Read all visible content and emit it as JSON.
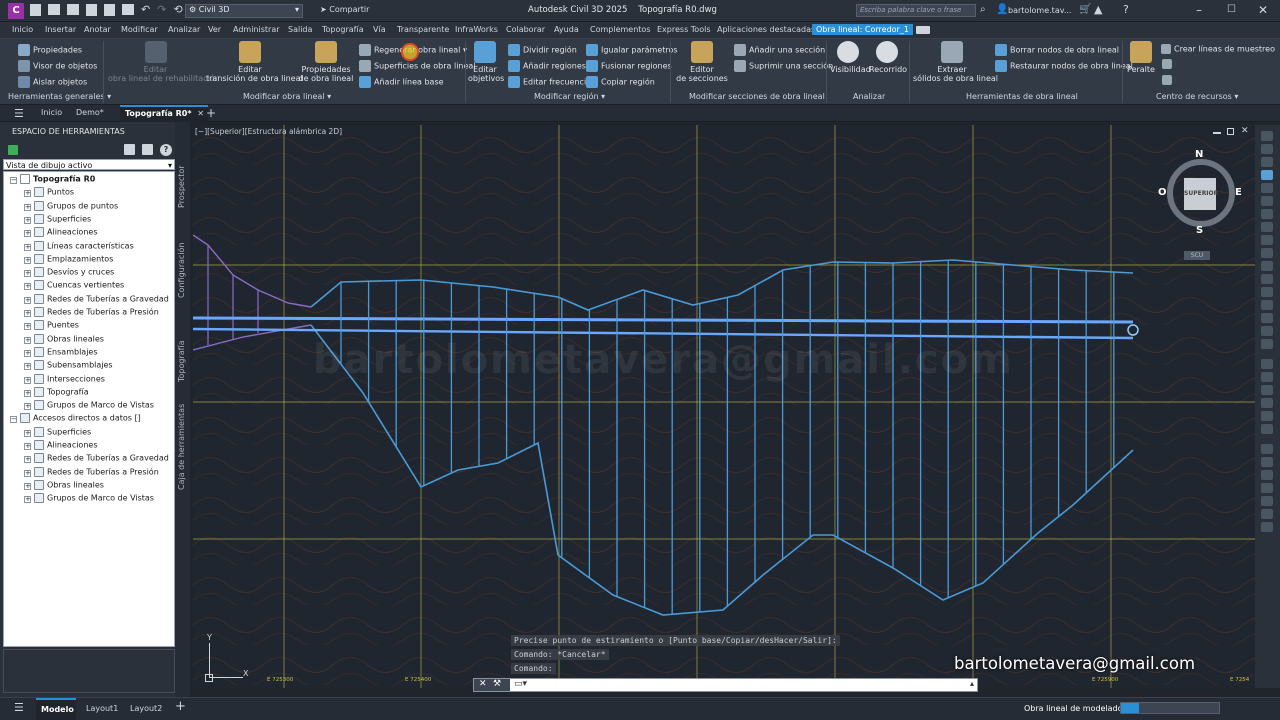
{
  "titlebar": {
    "app_badge": "C",
    "workspace": "Civil 3D",
    "share": "Compartir",
    "title": "Autodesk Civil 3D 2025    Topografía R0.dwg",
    "search_placeholder": "Escriba palabra clave o frase",
    "user": "bartolome.tav..."
  },
  "menu": [
    "Inicio",
    "Insertar",
    "Anotar",
    "Modificar",
    "Analizar",
    "Ver",
    "Administrar",
    "Salida",
    "Topografía",
    "Vía",
    "Transparente",
    "InfraWorks",
    "Colaborar",
    "Ayuda",
    "Complementos",
    "Express Tools",
    "Aplicaciones destacadas",
    "Obra lineal: Corredor_1"
  ],
  "ribbon": {
    "general": {
      "props": "Propiedades",
      "viewer": "Visor de objetos",
      "isolate": "Aislar objetos",
      "section": "Herramientas generales"
    },
    "modify_corridor": {
      "edit_rehab_1": "Editar",
      "edit_rehab_2": "obra lineal de rehabilitación",
      "edit_trans_1": "Editar",
      "edit_trans_2": "transición de obra lineal",
      "props_1": "Propiedades",
      "props_2": "de obra lineal",
      "regen": "Regenerar obra lineal",
      "surfaces": "Superficies de obra lineal",
      "add_baseline": "Añadir línea base",
      "section": "Modificar obra lineal"
    },
    "modify_region": {
      "edit_targets_1": "Editar",
      "edit_targets_2": "objetivos",
      "split": "Dividir región",
      "add": "Añadir regiones",
      "freq": "Editar frecuencia",
      "match": "Igualar parámetros",
      "merge": "Fusionar regiones",
      "copy": "Copiar región",
      "section": "Modificar región"
    },
    "modify_sections": {
      "editor_1": "Editor",
      "editor_2": "de secciones",
      "add": "Añadir una sección",
      "remove": "Suprimir una sección",
      "section": "Modificar secciones de obra lineal"
    },
    "analyze": {
      "visibility": "Visibilidad",
      "drive": "Recorrido",
      "section": "Analizar"
    },
    "tools": {
      "extract_1": "Extraer",
      "extract_2": "sólidos de obra lineal",
      "delete_nodes": "Borrar nodos de obra lineal",
      "restore_nodes": "Restaurar nodos de obra lineal",
      "section": "Herramientas de obra lineal"
    },
    "resources": {
      "profile": "Peralte",
      "sample": "Crear líneas de muestreo",
      "section": "Centro de recursos"
    }
  },
  "doctabs": [
    "Inicio",
    "Demo*",
    "Topografía R0*"
  ],
  "toolspace": {
    "title": "ESPACIO DE HERRAMIENTAS",
    "view_select": "Vista de dibujo activo",
    "side_tabs": [
      "Prospector",
      "Configuración",
      "Topografía",
      "Caja de herramientas"
    ],
    "tree": [
      {
        "label": "Topografía R0",
        "level": 0,
        "bold": true
      },
      {
        "label": "Puntos",
        "level": 1
      },
      {
        "label": "Grupos de puntos",
        "level": 1
      },
      {
        "label": "Superficies",
        "level": 1
      },
      {
        "label": "Alineaciones",
        "level": 1
      },
      {
        "label": "Líneas características",
        "level": 1
      },
      {
        "label": "Emplazamientos",
        "level": 1
      },
      {
        "label": "Desvíos y cruces",
        "level": 1
      },
      {
        "label": "Cuencas vertientes",
        "level": 1
      },
      {
        "label": "Redes de Tuberías a Gravedad",
        "level": 1
      },
      {
        "label": "Redes de Tuberías a Presión",
        "level": 1
      },
      {
        "label": "Puentes",
        "level": 1
      },
      {
        "label": "Obras lineales",
        "level": 1
      },
      {
        "label": "Ensamblajes",
        "level": 1
      },
      {
        "label": "Subensamblajes",
        "level": 1
      },
      {
        "label": "Intersecciones",
        "level": 1
      },
      {
        "label": "Topografía",
        "level": 1
      },
      {
        "label": "Grupos de Marco de Vistas",
        "level": 1
      },
      {
        "label": "Accesos directos a datos []",
        "level": 0
      },
      {
        "label": "Superficies",
        "level": 1
      },
      {
        "label": "Alineaciones",
        "level": 1
      },
      {
        "label": "Redes de Tuberías a Gravedad",
        "level": 1
      },
      {
        "label": "Redes de Tuberías a Presión",
        "level": 1
      },
      {
        "label": "Obras lineales",
        "level": 1
      },
      {
        "label": "Grupos de Marco de Vistas",
        "level": 1
      }
    ]
  },
  "viewport": {
    "label": "[−][Superior][Estructura alámbrica 2D]",
    "compass": {
      "n": "N",
      "s": "S",
      "e": "E",
      "w": "O",
      "cube": "SUPERIOR",
      "wcs": "SCU"
    },
    "watermark": "bartolometavera@gmail.com",
    "x_ticks": [
      "E 725300",
      "E 725400",
      "E 725900",
      "E 7254"
    ],
    "ucs": {
      "x": "X",
      "y": "Y"
    }
  },
  "command": {
    "line1": "Precise punto de estiramiento o [Punto base/Copiar/desHacer/Salir]:",
    "line2": "Comando: *Cancelar*",
    "line3": "Comando:"
  },
  "signature": "bartolometavera@gmail.com",
  "statusbar": {
    "tabs": [
      "Modelo",
      "Layout1",
      "Layout2"
    ],
    "mode": "Obra lineal de modelado"
  },
  "colors": {
    "accent": "#2b8fd8",
    "corridor": "#4a9ad8",
    "grid": "#c8c24a",
    "contour": "#b9572f"
  }
}
